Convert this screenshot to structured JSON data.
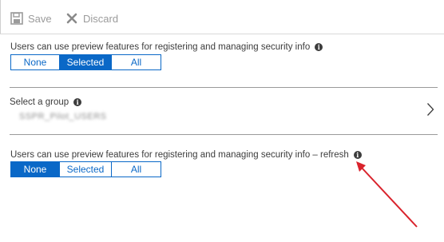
{
  "toolbar": {
    "save_label": "Save",
    "discard_label": "Discard"
  },
  "setting1": {
    "label": "Users can use preview features for registering and managing security info",
    "options": [
      "None",
      "Selected",
      "All"
    ],
    "selected": "Selected"
  },
  "group": {
    "label": "Select a group",
    "value": "SSPR_Pilot_USERS"
  },
  "setting2": {
    "label": "Users can use preview features for registering and managing security info – refresh",
    "options": [
      "None",
      "Selected",
      "All"
    ],
    "selected": "None"
  },
  "colors": {
    "accent": "#0a68c7",
    "annotation_arrow": "#d9232c"
  },
  "icons": {
    "save": "save-icon",
    "discard": "close-icon",
    "info": "info-icon",
    "chevron": "chevron-right-icon"
  }
}
